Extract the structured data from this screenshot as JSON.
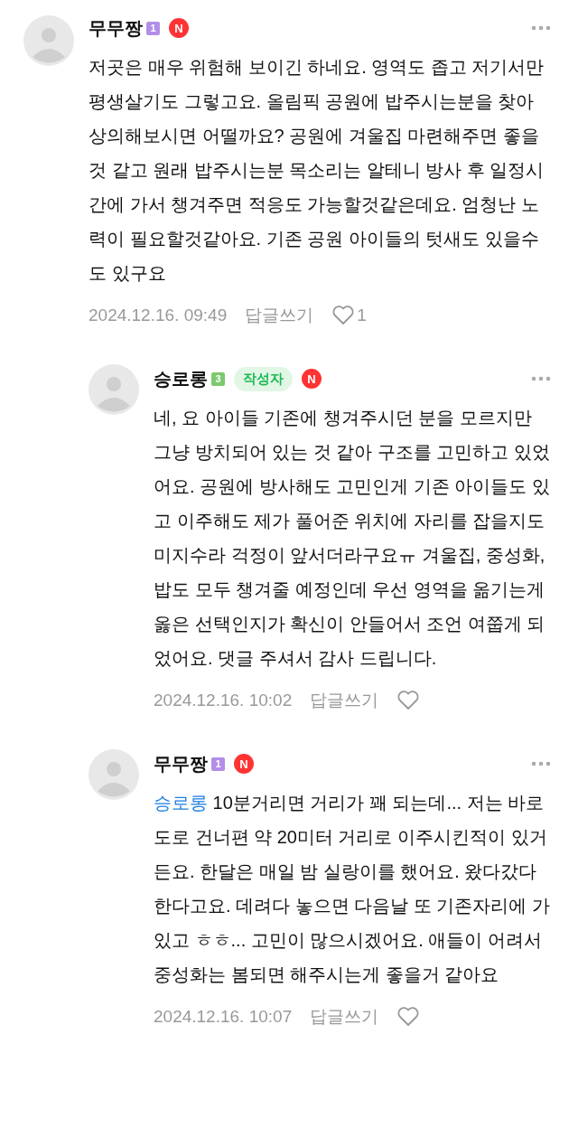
{
  "comments": [
    {
      "kind": "top",
      "author": "무무짱",
      "level": "1",
      "color": "#b38ee8",
      "new_badge": "N",
      "text": "저곳은 매우 위험해 보이긴 하네요. 영역도 좁고 저기서만 평생살기도 그렇고요. 올림픽 공원에 밥주시는분을 찾아 상의해보시면 어떨까요? 공원에 겨울집 마련해주면 좋을것 같고 원래 밥주시는분 목소리는 알테니 방사 후 일정시간에 가서 챙겨주면 적응도 가능할것같은데요. 엄청난 노력이 필요할것같아요. 기존 공원 아이들의 텃새도 있을수도 있구요",
      "date": "2024.12.16. 09:49",
      "reply": "답글쓰기",
      "likes": "1"
    },
    {
      "kind": "reply",
      "author": "승로롱",
      "level": "3",
      "color": "#7cc86e",
      "writer_badge": "작성자",
      "new_badge": "N",
      "text": "네, 요 아이들 기존에 챙겨주시던 분을 모르지만 그냥 방치되어 있는 것 같아 구조를 고민하고 있었어요. 공원에 방사해도 고민인게 기존 아이들도 있고 이주해도 제가 풀어준 위치에 자리를 잡을지도 미지수라 걱정이 앞서더라구요ㅠ 겨울집, 중성화, 밥도 모두 챙겨줄 예정인데 우선 영역을 옮기는게 옳은 선택인지가 확신이 안들어서 조언 여쭙게 되었어요. 댓글 주셔서 감사 드립니다.",
      "date": "2024.12.16. 10:02",
      "reply": "답글쓰기"
    },
    {
      "kind": "reply",
      "author": "무무짱",
      "level": "1",
      "color": "#b38ee8",
      "new_badge": "N",
      "mention": "승로롱",
      "text": "10분거리면 거리가 꽤 되는데... 저는 바로 도로 건너편 약 20미터 거리로 이주시킨적이 있거든요. 한달은 매일 밤 실랑이를 했어요. 왔다갔다 한다고요. 데려다 놓으면 다음날 또 기존자리에 가있고 ㅎㅎ... 고민이 많으시겠어요. 애들이 어려서 중성화는 봄되면 해주시는게 좋을거 같아요",
      "date": "2024.12.16. 10:07",
      "reply": "답글쓰기"
    }
  ]
}
